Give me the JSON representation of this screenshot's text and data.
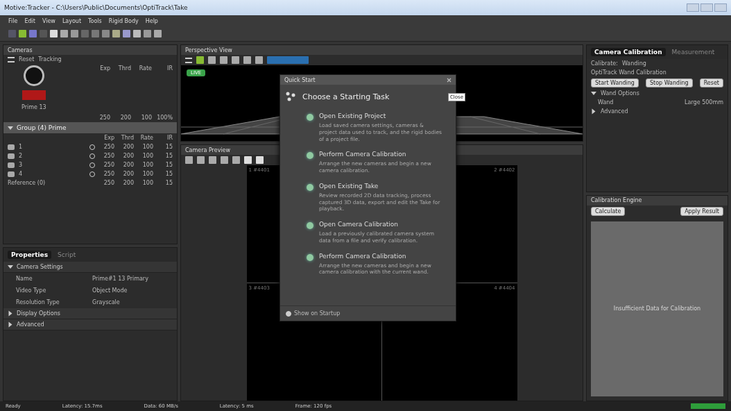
{
  "window": {
    "title": "Motive:Tracker - C:\\Users\\Public\\Documents\\OptiTrack\\Take"
  },
  "menu": [
    "File",
    "Edit",
    "View",
    "Layout",
    "Tools",
    "Rigid Body",
    "Help"
  ],
  "cameras": {
    "title": "Cameras",
    "tools": [
      "Reset",
      "Tracking"
    ],
    "columns": [
      "Exp",
      "Thrd",
      "Rate",
      "IR"
    ],
    "preview_label": "Prime 13",
    "preview_values": [
      "250",
      "200",
      "100",
      "100%"
    ],
    "group": {
      "label": "Group (4) Prime",
      "expanded": true,
      "columns": [
        "Exp",
        "Thrd",
        "Rate",
        "IR"
      ],
      "rows": [
        {
          "label": "1",
          "values": [
            "250",
            "200",
            "100",
            "15"
          ]
        },
        {
          "label": "2",
          "values": [
            "250",
            "200",
            "100",
            "15"
          ]
        },
        {
          "label": "3",
          "values": [
            "250",
            "200",
            "100",
            "15"
          ]
        },
        {
          "label": "4",
          "values": [
            "250",
            "200",
            "100",
            "15"
          ]
        }
      ]
    },
    "reference": {
      "label": "Reference (0)",
      "values": [
        "250",
        "200",
        "100",
        "15"
      ]
    }
  },
  "properties": {
    "tabs": [
      {
        "label": "Properties",
        "selected": true
      },
      {
        "label": "Script",
        "selected": false
      }
    ],
    "sections": [
      {
        "label": "Camera Settings",
        "expanded": true,
        "rows": [
          {
            "name": "Name",
            "value": "Prime#1 13 Primary"
          },
          {
            "name": "Video Type",
            "value": "Object Mode"
          },
          {
            "name": "Resolution Type",
            "value": "Grayscale"
          }
        ]
      },
      {
        "label": "Display Options",
        "expanded": false
      },
      {
        "label": "Advanced",
        "expanded": false
      }
    ]
  },
  "perspective": {
    "title": "Perspective View",
    "live": "LIVE",
    "live_on": true
  },
  "preview": {
    "title": "Camera Preview",
    "views": [
      "1 #4401",
      "2 #4402",
      "3 #4403",
      "4 #4404"
    ]
  },
  "dialog": {
    "title": "Quick Start",
    "heading": "Choose a Starting Task",
    "tooltip": "Close",
    "tasks": [
      {
        "title": "Open Existing Project",
        "text": "Load saved camera settings, cameras & project data used to track, and the rigid bodies of a project file."
      },
      {
        "title": "Perform Camera Calibration",
        "text": "Arrange the new cameras and begin a new camera calibration."
      },
      {
        "title": "Open Existing Take",
        "text": "Review recorded 2D data tracking, process captured 3D data, export and edit the Take for playback."
      },
      {
        "title": "Open Camera Calibration",
        "text": "Load a previously calibrated camera system data from a file and verify calibration."
      },
      {
        "title": "Perform Camera Calibration",
        "text": "Arrange the new cameras and begin a new camera calibration with the current wand."
      }
    ],
    "show_on_startup": {
      "label": "Show on Startup",
      "checked": true
    }
  },
  "calibration": {
    "tabs": [
      {
        "label": "Camera Calibration",
        "selected": true
      },
      {
        "label": "Measurement",
        "selected": false
      }
    ],
    "mode_label": "Calibrate:",
    "mode_value": "Wanding",
    "section": "OptiTrack Wand Calibration",
    "buttons": [
      "Start Wanding",
      "Stop Wanding",
      "Reset"
    ],
    "options": [
      {
        "label": "Wand Options",
        "expanded": true,
        "name": "Wand",
        "value": "Large 500mm"
      },
      {
        "label": "Advanced",
        "expanded": false
      }
    ],
    "engine": "Calibration Engine",
    "engine_buttons": [
      "Calculate",
      "Apply Result"
    ],
    "result": "Insufficient Data for Calibration"
  },
  "status": [
    "Ready",
    "Latency: 15.7ms",
    "Data: 60 MB/s",
    "Latency: 5 ms",
    "Frame: 120 fps"
  ]
}
